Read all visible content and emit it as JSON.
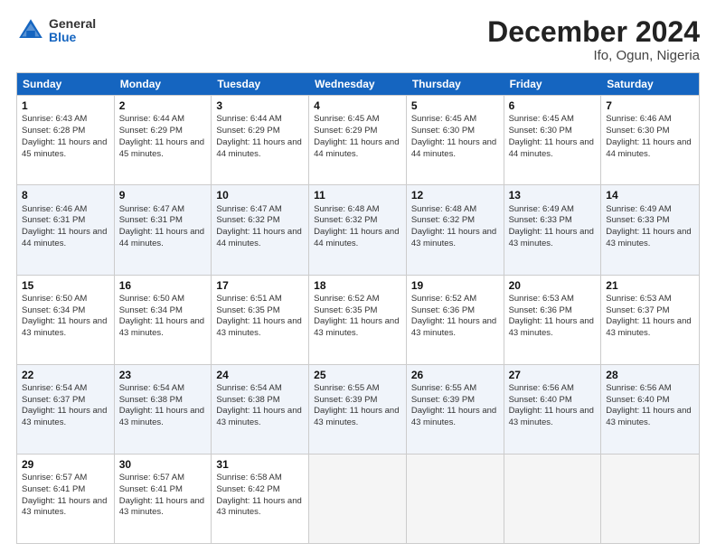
{
  "logo": {
    "general": "General",
    "blue": "Blue"
  },
  "title": "December 2024",
  "subtitle": "Ifo, Ogun, Nigeria",
  "days": [
    "Sunday",
    "Monday",
    "Tuesday",
    "Wednesday",
    "Thursday",
    "Friday",
    "Saturday"
  ],
  "weeks": [
    [
      {
        "day": "1",
        "sunrise": "6:43 AM",
        "sunset": "6:28 PM",
        "daylight": "11 hours and 45 minutes."
      },
      {
        "day": "2",
        "sunrise": "6:44 AM",
        "sunset": "6:29 PM",
        "daylight": "11 hours and 45 minutes."
      },
      {
        "day": "3",
        "sunrise": "6:44 AM",
        "sunset": "6:29 PM",
        "daylight": "11 hours and 44 minutes."
      },
      {
        "day": "4",
        "sunrise": "6:45 AM",
        "sunset": "6:29 PM",
        "daylight": "11 hours and 44 minutes."
      },
      {
        "day": "5",
        "sunrise": "6:45 AM",
        "sunset": "6:30 PM",
        "daylight": "11 hours and 44 minutes."
      },
      {
        "day": "6",
        "sunrise": "6:45 AM",
        "sunset": "6:30 PM",
        "daylight": "11 hours and 44 minutes."
      },
      {
        "day": "7",
        "sunrise": "6:46 AM",
        "sunset": "6:30 PM",
        "daylight": "11 hours and 44 minutes."
      }
    ],
    [
      {
        "day": "8",
        "sunrise": "6:46 AM",
        "sunset": "6:31 PM",
        "daylight": "11 hours and 44 minutes."
      },
      {
        "day": "9",
        "sunrise": "6:47 AM",
        "sunset": "6:31 PM",
        "daylight": "11 hours and 44 minutes."
      },
      {
        "day": "10",
        "sunrise": "6:47 AM",
        "sunset": "6:32 PM",
        "daylight": "11 hours and 44 minutes."
      },
      {
        "day": "11",
        "sunrise": "6:48 AM",
        "sunset": "6:32 PM",
        "daylight": "11 hours and 44 minutes."
      },
      {
        "day": "12",
        "sunrise": "6:48 AM",
        "sunset": "6:32 PM",
        "daylight": "11 hours and 43 minutes."
      },
      {
        "day": "13",
        "sunrise": "6:49 AM",
        "sunset": "6:33 PM",
        "daylight": "11 hours and 43 minutes."
      },
      {
        "day": "14",
        "sunrise": "6:49 AM",
        "sunset": "6:33 PM",
        "daylight": "11 hours and 43 minutes."
      }
    ],
    [
      {
        "day": "15",
        "sunrise": "6:50 AM",
        "sunset": "6:34 PM",
        "daylight": "11 hours and 43 minutes."
      },
      {
        "day": "16",
        "sunrise": "6:50 AM",
        "sunset": "6:34 PM",
        "daylight": "11 hours and 43 minutes."
      },
      {
        "day": "17",
        "sunrise": "6:51 AM",
        "sunset": "6:35 PM",
        "daylight": "11 hours and 43 minutes."
      },
      {
        "day": "18",
        "sunrise": "6:52 AM",
        "sunset": "6:35 PM",
        "daylight": "11 hours and 43 minutes."
      },
      {
        "day": "19",
        "sunrise": "6:52 AM",
        "sunset": "6:36 PM",
        "daylight": "11 hours and 43 minutes."
      },
      {
        "day": "20",
        "sunrise": "6:53 AM",
        "sunset": "6:36 PM",
        "daylight": "11 hours and 43 minutes."
      },
      {
        "day": "21",
        "sunrise": "6:53 AM",
        "sunset": "6:37 PM",
        "daylight": "11 hours and 43 minutes."
      }
    ],
    [
      {
        "day": "22",
        "sunrise": "6:54 AM",
        "sunset": "6:37 PM",
        "daylight": "11 hours and 43 minutes."
      },
      {
        "day": "23",
        "sunrise": "6:54 AM",
        "sunset": "6:38 PM",
        "daylight": "11 hours and 43 minutes."
      },
      {
        "day": "24",
        "sunrise": "6:54 AM",
        "sunset": "6:38 PM",
        "daylight": "11 hours and 43 minutes."
      },
      {
        "day": "25",
        "sunrise": "6:55 AM",
        "sunset": "6:39 PM",
        "daylight": "11 hours and 43 minutes."
      },
      {
        "day": "26",
        "sunrise": "6:55 AM",
        "sunset": "6:39 PM",
        "daylight": "11 hours and 43 minutes."
      },
      {
        "day": "27",
        "sunrise": "6:56 AM",
        "sunset": "6:40 PM",
        "daylight": "11 hours and 43 minutes."
      },
      {
        "day": "28",
        "sunrise": "6:56 AM",
        "sunset": "6:40 PM",
        "daylight": "11 hours and 43 minutes."
      }
    ],
    [
      {
        "day": "29",
        "sunrise": "6:57 AM",
        "sunset": "6:41 PM",
        "daylight": "11 hours and 43 minutes."
      },
      {
        "day": "30",
        "sunrise": "6:57 AM",
        "sunset": "6:41 PM",
        "daylight": "11 hours and 43 minutes."
      },
      {
        "day": "31",
        "sunrise": "6:58 AM",
        "sunset": "6:42 PM",
        "daylight": "11 hours and 43 minutes."
      },
      null,
      null,
      null,
      null
    ]
  ],
  "labels": {
    "sunrise": "Sunrise: ",
    "sunset": "Sunset: ",
    "daylight": "Daylight: "
  }
}
